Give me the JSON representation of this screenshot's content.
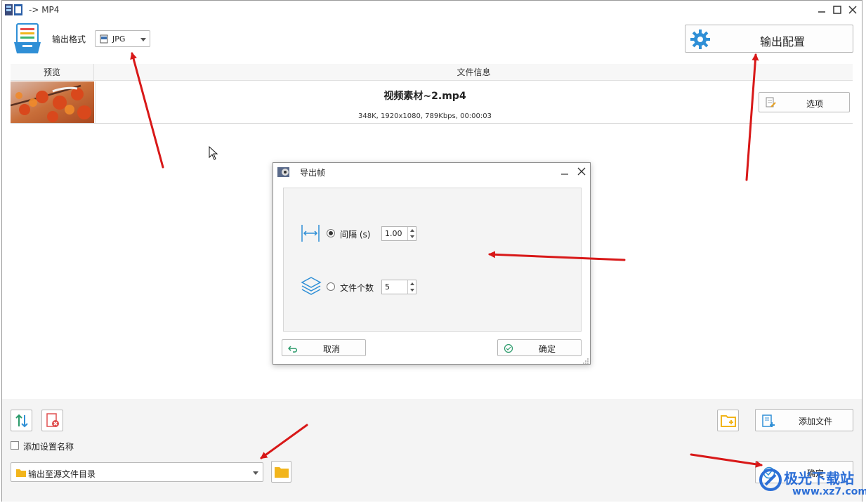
{
  "window": {
    "title": "-> MP4"
  },
  "toolbar": {
    "format_label": "输出格式",
    "format_value": "JPG",
    "output_config_label": "输出配置"
  },
  "table": {
    "headers": [
      "预览",
      "文件信息"
    ],
    "rows": [
      {
        "filename": "视频素材~2.mp4",
        "details": "348K, 1920x1080, 789Kbps, 00:00:03",
        "options_label": "选项"
      }
    ]
  },
  "bottom": {
    "add_file_label": "添加文件",
    "add_settings_name_label": "添加设置名称",
    "output_dir_value": "输出至源文件目录",
    "confirm_label": "确定"
  },
  "dialog": {
    "title": "导出帧",
    "interval_label": "间隔 (s)",
    "interval_value": "1.00",
    "count_label": "文件个数",
    "count_value": "5",
    "cancel_label": "取消",
    "ok_label": "确定"
  },
  "watermark": {
    "brand": "极光下载站",
    "url": "www.xz7.com"
  },
  "colors": {
    "accent_blue": "#2f8fd6",
    "arrow_red": "#d81818",
    "folder_yellow": "#f2b51c"
  }
}
